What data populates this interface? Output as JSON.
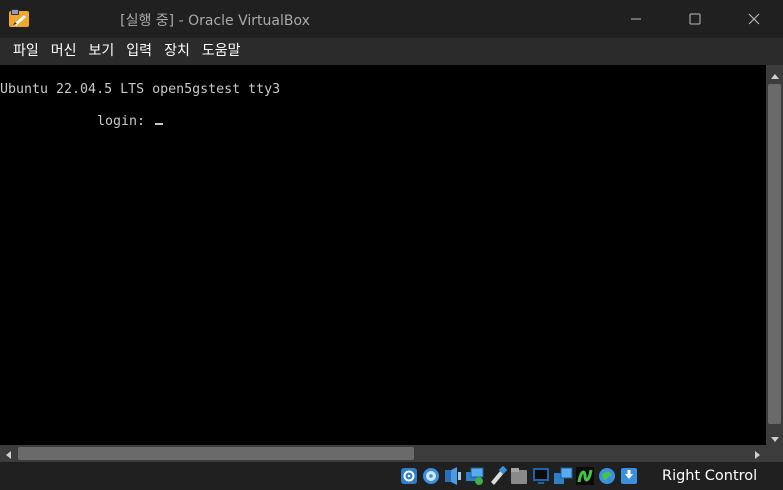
{
  "window": {
    "title": "[실행 중] - Oracle VirtualBox",
    "controls": {
      "minimize": "minimize-icon",
      "maximize": "maximize-icon",
      "close": "close-icon"
    }
  },
  "menu": {
    "items": [
      {
        "label": "파일"
      },
      {
        "label": "머신"
      },
      {
        "label": "보기"
      },
      {
        "label": "입력"
      },
      {
        "label": "장치"
      },
      {
        "label": "도움말"
      }
    ]
  },
  "console": {
    "banner": "Ubuntu 22.04.5 LTS open5gstest tty3",
    "prompt": "login: "
  },
  "status_bar": {
    "icons": [
      "hard-disk-icon",
      "optical-drive-icon",
      "audio-icon",
      "network-icon",
      "usb-icon",
      "shared-folders-icon",
      "display-icon",
      "recording-icon",
      "guest-additions-icon",
      "cpu-icon",
      "mouse-integration-icon"
    ],
    "host_key": "Right Control"
  },
  "colors": {
    "terminal_bg": "#000000",
    "terminal_fg": "#c8c8c8",
    "chrome_bg": "#202020",
    "menubar_bg": "#2b2b2b"
  }
}
